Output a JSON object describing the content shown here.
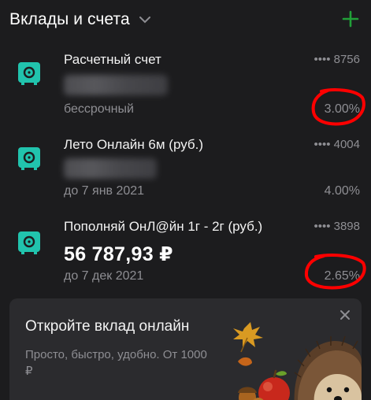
{
  "header": {
    "title": "Вклады и счета",
    "add_icon": "plus-icon",
    "chevron_icon": "chevron-down-icon",
    "accent_color": "#21a038"
  },
  "accounts": [
    {
      "name": "Расчетный счет",
      "mask": "•••• 8756",
      "balance_hidden": true,
      "term": "бессрочный",
      "rate": "3.00%",
      "rate_highlighted": true,
      "icon": "safe-icon"
    },
    {
      "name": "Лето Онлайн 6м (руб.)",
      "mask": "•••• 4004",
      "balance_hidden": true,
      "term": "до 7 янв 2021",
      "rate": "4.00%",
      "rate_highlighted": false,
      "icon": "safe-icon"
    },
    {
      "name": "Пополняй ОнЛ@йн 1г - 2г (руб.)",
      "mask": "•••• 3898",
      "balance": "56 787,93 ₽",
      "term": "до 7 дек 2021",
      "rate": "2.65%",
      "rate_highlighted": true,
      "icon": "safe-icon"
    }
  ],
  "promo": {
    "title": "Откройте вклад онлайн",
    "text": "Просто, быстро, удобно. От 1000 ₽",
    "close_icon": "close-icon",
    "illustration": "hedgehog-apple-illustration"
  },
  "colors": {
    "background": "#1c1c1e",
    "card": "#2b2b2e",
    "icon_teal": "#21c3ad",
    "highlight_red": "#ff0000",
    "muted_text": "#8e8e93"
  }
}
